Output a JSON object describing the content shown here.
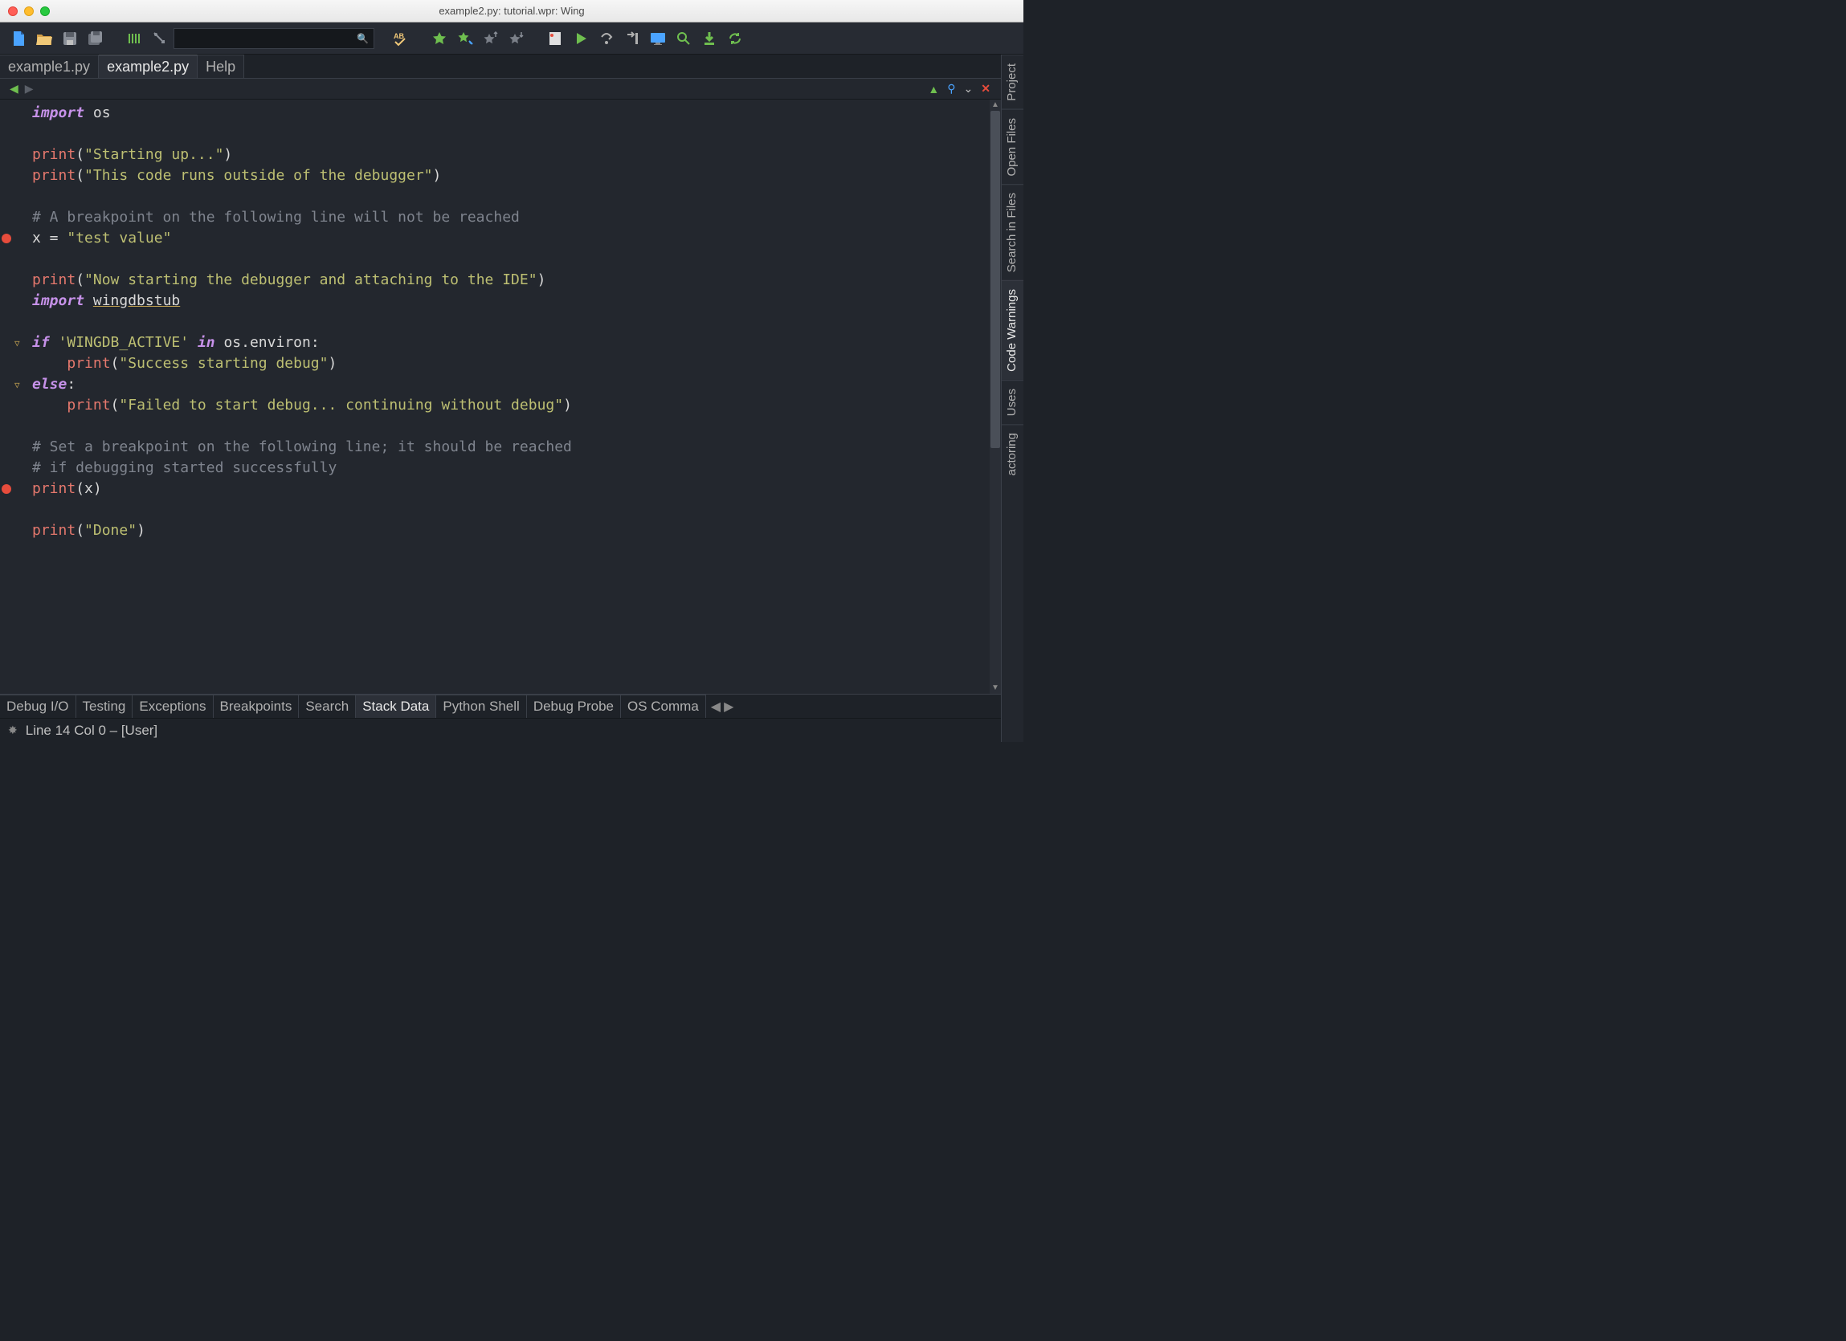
{
  "window": {
    "title": "example2.py: tutorial.wpr: Wing"
  },
  "toolbar": {
    "icons": [
      "new-file-icon",
      "open-folder-icon",
      "save-icon",
      "save-all-icon",
      "indent-guide-icon",
      "pointer-icon"
    ],
    "search": {
      "value": ""
    },
    "icons2": [
      "spell-check-icon",
      "bookmark-icon",
      "bookmark-add-icon",
      "bookmark-prev-icon",
      "bookmark-next-icon",
      "breakpoint-icon",
      "run-icon",
      "step-over-icon",
      "step-into-icon",
      "monitor-icon",
      "magnify-icon",
      "download-icon",
      "refresh-icon"
    ]
  },
  "file_tabs": [
    {
      "label": "example1.py",
      "active": false
    },
    {
      "label": "example2.py",
      "active": true
    },
    {
      "label": "Help",
      "active": false
    }
  ],
  "editor_sub": {
    "warn": "⚠",
    "pin": "📌",
    "menu": "⌄",
    "close": "✕"
  },
  "code": {
    "lines": [
      {
        "t": "import_stmt",
        "keyword": "import",
        "rest": " os"
      },
      {
        "t": "blank"
      },
      {
        "t": "print",
        "fn": "print",
        "open": "(",
        "str": "\"Starting up...\"",
        "close": ")"
      },
      {
        "t": "print",
        "fn": "print",
        "open": "(",
        "str": "\"This code runs outside of the debugger\"",
        "close": ")"
      },
      {
        "t": "blank"
      },
      {
        "t": "comment",
        "text": "# A breakpoint on the following line will not be reached"
      },
      {
        "t": "assign",
        "lhs": "x = ",
        "str": "\"test value\"",
        "breakpoint": true
      },
      {
        "t": "blank"
      },
      {
        "t": "print",
        "fn": "print",
        "open": "(",
        "str": "\"Now starting the debugger and attaching to the IDE\"",
        "close": ")"
      },
      {
        "t": "import_underline",
        "keyword": "import",
        "module": "wingdbstub"
      },
      {
        "t": "blank"
      },
      {
        "t": "if",
        "keyword": "if",
        "pre": " ",
        "str": "'WINGDB_ACTIVE'",
        "mid_kw": "in",
        "post": " os.environ:",
        "fold": true
      },
      {
        "t": "print_indent",
        "indent": "    ",
        "fn": "print",
        "open": "(",
        "str": "\"Success starting debug\"",
        "close": ")"
      },
      {
        "t": "else",
        "keyword": "else",
        "post": ":",
        "fold": true
      },
      {
        "t": "print_indent",
        "indent": "    ",
        "fn": "print",
        "open": "(",
        "str": "\"Failed to start debug... continuing without debug\"",
        "close": ")"
      },
      {
        "t": "blank"
      },
      {
        "t": "comment",
        "text": "# Set a breakpoint on the following line; it should be reached"
      },
      {
        "t": "comment",
        "text": "# if debugging started successfully"
      },
      {
        "t": "print_var",
        "fn": "print",
        "open": "(",
        "var": "x",
        "close": ")",
        "breakpoint": true
      },
      {
        "t": "blank"
      },
      {
        "t": "print",
        "fn": "print",
        "open": "(",
        "str": "\"Done\"",
        "close": ")"
      },
      {
        "t": "blank"
      },
      {
        "t": "blank"
      }
    ]
  },
  "side_tabs": [
    {
      "label": "Project",
      "active": false
    },
    {
      "label": "Open Files",
      "active": false
    },
    {
      "label": "Search in Files",
      "active": false
    },
    {
      "label": "Code Warnings",
      "active": true
    },
    {
      "label": "Uses",
      "active": false
    },
    {
      "label": "actoring",
      "active": false
    }
  ],
  "bottom_tabs": [
    {
      "label": "Debug I/O",
      "active": false
    },
    {
      "label": "Testing",
      "active": false
    },
    {
      "label": "Exceptions",
      "active": false
    },
    {
      "label": "Breakpoints",
      "active": false
    },
    {
      "label": "Search",
      "active": false
    },
    {
      "label": "Stack Data",
      "active": true
    },
    {
      "label": "Python Shell",
      "active": false
    },
    {
      "label": "Debug Probe",
      "active": false
    },
    {
      "label": "OS Comma",
      "active": false
    }
  ],
  "status": {
    "text": "Line 14 Col 0 – [User]"
  },
  "colors": {
    "bg": "#23272e",
    "keyword": "#c792ea",
    "function": "#e5786d",
    "string": "#bdbf72",
    "comment": "#7f848e"
  }
}
